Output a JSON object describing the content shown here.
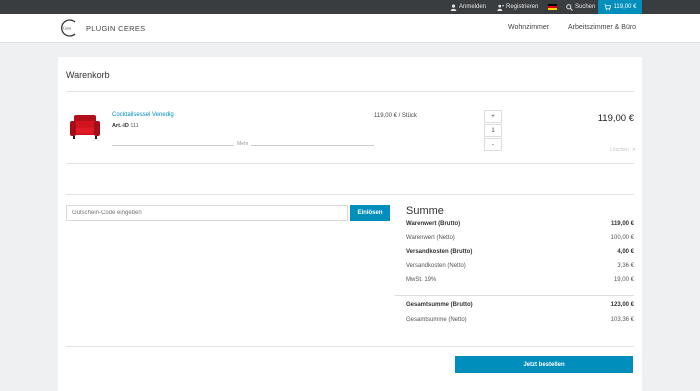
{
  "topbar": {
    "login": "Anmelden",
    "register": "Registrieren",
    "search": "Suchen",
    "cart_total": "119,00 €"
  },
  "header": {
    "logo_small": "Ceres",
    "brand": "PLUGIN CERES",
    "nav": [
      "Wohnzimmer",
      "Arbeitszimmer & Büro"
    ]
  },
  "cart": {
    "title": "Warenkorb",
    "item": {
      "name": "Cocktailsessel Venedig",
      "art_label": "Art.-ID",
      "art_id": "111",
      "more": "Mehr",
      "unit_price": "119,00 € / Stück",
      "qty_plus": "+",
      "quantity": "1",
      "qty_minus": "-",
      "total": "119,00 €",
      "delete": "Löschen",
      "delete_x": "✕"
    }
  },
  "coupon": {
    "placeholder": "Gutschein-Code eingeben",
    "button": "Einlösen"
  },
  "summary": {
    "title": "Summe",
    "rows": [
      {
        "label": "Warenwert (Brutto)",
        "value": "119,00 €"
      },
      {
        "label": "Warenwert (Netto)",
        "value": "100,00 €"
      },
      {
        "label": "Versandkosten (Brutto)",
        "value": "4,00 €"
      },
      {
        "label": "Versandkosten (Netto)",
        "value": "3,36 €"
      },
      {
        "label": "MwSt. 19%",
        "value": "19,00 €"
      },
      {
        "label": "Gesamtsumme (Brutto)",
        "value": "123,00 €"
      },
      {
        "label": "Gesamtsumme (Netto)",
        "value": "103,36 €"
      }
    ]
  },
  "order_button": "Jetzt bestellen",
  "colors": {
    "accent": "#008ebd",
    "topbar": "#3a3d40",
    "background": "#eef0f2"
  }
}
